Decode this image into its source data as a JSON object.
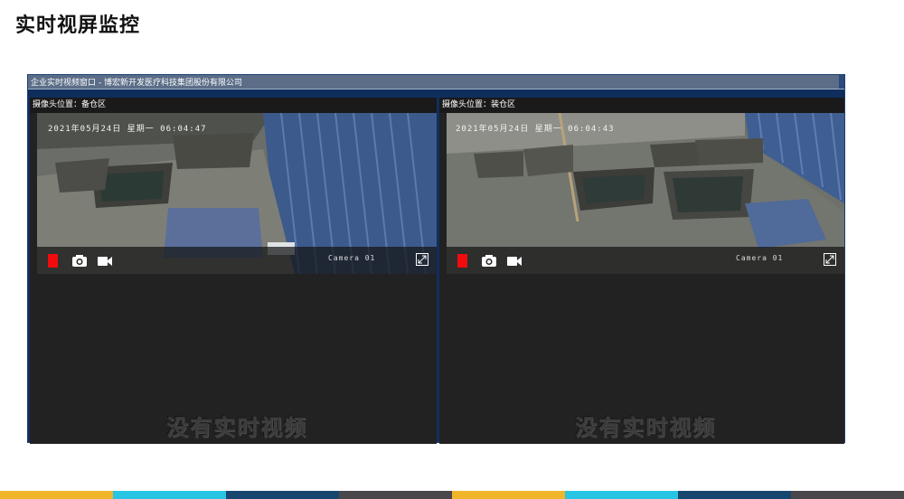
{
  "page_title": "实时视屏监控",
  "window": {
    "title": "企业实时视频窗口 - 博宏新开发医疗科技集团股份有限公司"
  },
  "panels": [
    {
      "header": "摄像头位置：备仓区",
      "osd_datetime": "2021年05月24日  星期一  06:04:47",
      "camera_label": "Camera 01",
      "no_video_text": "没有实时视频"
    },
    {
      "header": "摄像头位置：装仓区",
      "osd_datetime": "2021年05月24日  星期一  06:04:43",
      "camera_label": "Camera 01",
      "no_video_text": "没有实时视频"
    }
  ],
  "icons": {
    "record": "record-icon",
    "snapshot": "camera-icon",
    "video": "video-camera-icon",
    "fullscreen": "fullscreen-icon"
  },
  "colors": {
    "window_bg": "#0f2e5c",
    "panel_bg": "#222222",
    "record_red": "#f00c0c",
    "footer": [
      "#f1b52b",
      "#27c5e3",
      "#17466f",
      "#49474a",
      "#f1b52b",
      "#27c5e3",
      "#17466f",
      "#49474a"
    ]
  }
}
